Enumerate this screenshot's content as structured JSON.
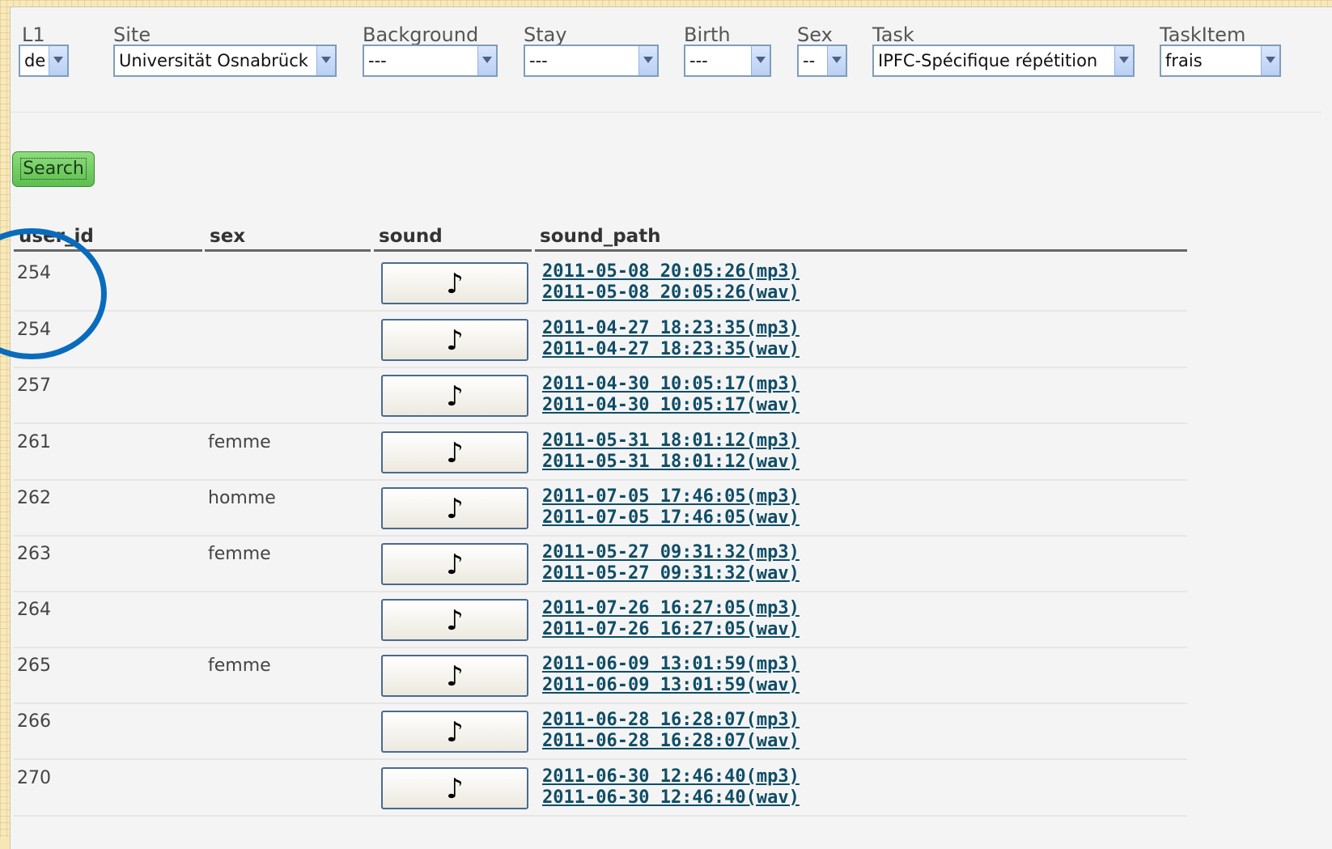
{
  "filters": [
    {
      "label": "L1",
      "value": "de"
    },
    {
      "label": "Site",
      "value": "Universität Osnabrück"
    },
    {
      "label": "Background",
      "value": "---"
    },
    {
      "label": "Stay",
      "value": "---"
    },
    {
      "label": "Birth",
      "value": "---"
    },
    {
      "label": "Sex",
      "value": "--"
    },
    {
      "label": "Task",
      "value": "IPFC-Spécifique répétition"
    },
    {
      "label": "TaskItem",
      "value": "frais"
    }
  ],
  "search_label": "Search",
  "columns": [
    "user_id",
    "sex",
    "sound",
    "sound_path"
  ],
  "play_glyph": "♪",
  "rows": [
    {
      "user_id": "254",
      "sex": "",
      "mp3": "2011-05-08 20:05:26(mp3)",
      "wav": "2011-05-08 20:05:26(wav)"
    },
    {
      "user_id": "254",
      "sex": "",
      "mp3": "2011-04-27 18:23:35(mp3)",
      "wav": "2011-04-27 18:23:35(wav)"
    },
    {
      "user_id": "257",
      "sex": "",
      "mp3": "2011-04-30 10:05:17(mp3)",
      "wav": "2011-04-30 10:05:17(wav)"
    },
    {
      "user_id": "261",
      "sex": "femme",
      "mp3": "2011-05-31 18:01:12(mp3)",
      "wav": "2011-05-31 18:01:12(wav)"
    },
    {
      "user_id": "262",
      "sex": "homme",
      "mp3": "2011-07-05 17:46:05(mp3)",
      "wav": "2011-07-05 17:46:05(wav)"
    },
    {
      "user_id": "263",
      "sex": "femme",
      "mp3": "2011-05-27 09:31:32(mp3)",
      "wav": "2011-05-27 09:31:32(wav)"
    },
    {
      "user_id": "264",
      "sex": "",
      "mp3": "2011-07-26 16:27:05(mp3)",
      "wav": "2011-07-26 16:27:05(wav)"
    },
    {
      "user_id": "265",
      "sex": "femme",
      "mp3": "2011-06-09 13:01:59(mp3)",
      "wav": "2011-06-09 13:01:59(wav)"
    },
    {
      "user_id": "266",
      "sex": "",
      "mp3": "2011-06-28 16:28:07(mp3)",
      "wav": "2011-06-28 16:28:07(wav)"
    },
    {
      "user_id": "270",
      "sex": "",
      "mp3": "2011-06-30 12:46:40(mp3)",
      "wav": "2011-06-30 12:46:40(wav)"
    }
  ],
  "annotation_color": "#0a6bbd"
}
